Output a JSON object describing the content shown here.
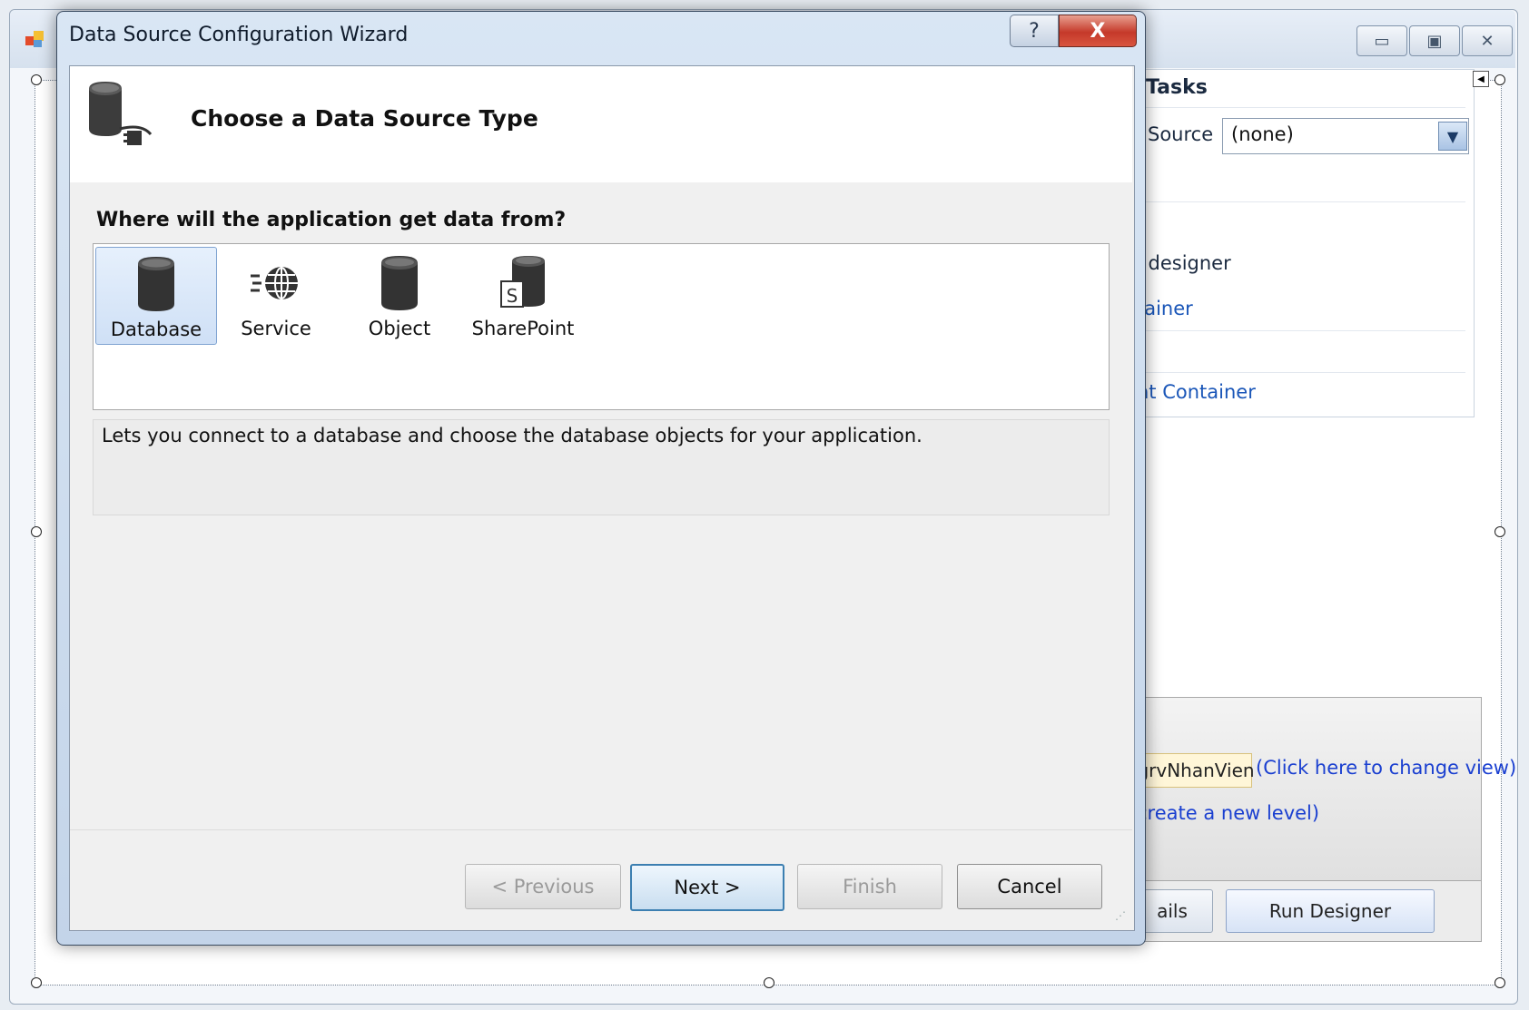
{
  "dialog": {
    "title": "Data Source Configuration Wizard",
    "help_glyph": "?",
    "close_glyph": "X"
  },
  "header": {
    "title": "Choose a Data Source Type"
  },
  "question": "Where will the application get data from?",
  "data_source_types": [
    {
      "label": "Database",
      "icon": "database-icon",
      "selected": true
    },
    {
      "label": "Service",
      "icon": "service-globe-icon",
      "selected": false
    },
    {
      "label": "Object",
      "icon": "object-icon",
      "selected": false
    },
    {
      "label": "SharePoint",
      "icon": "sharepoint-icon",
      "selected": false
    }
  ],
  "description": "Lets you connect to a database and choose the database objects for your application.",
  "buttons": {
    "previous": "< Previous",
    "next": "Next >",
    "finish": "Finish",
    "cancel": "Cancel"
  },
  "background": {
    "window_buttons": [
      "▭",
      "▣",
      "✕"
    ],
    "tasks_title": "Tasks",
    "data_source_label": "Source",
    "data_source_value": "(none)",
    "combo_arrow": "▼",
    "items": [
      "l designer",
      "tainer",
      "nt Container"
    ],
    "view_name": "grvNhanVien",
    "change_view_link": "(Click here to change view)",
    "new_level_link": "create a new level)",
    "details_button": "ails",
    "run_designer_button": "Run Designer"
  },
  "colors": {
    "selected_item_bg": "#cfe0f6",
    "link": "#1a56b8",
    "close_button": "#c5392a"
  }
}
